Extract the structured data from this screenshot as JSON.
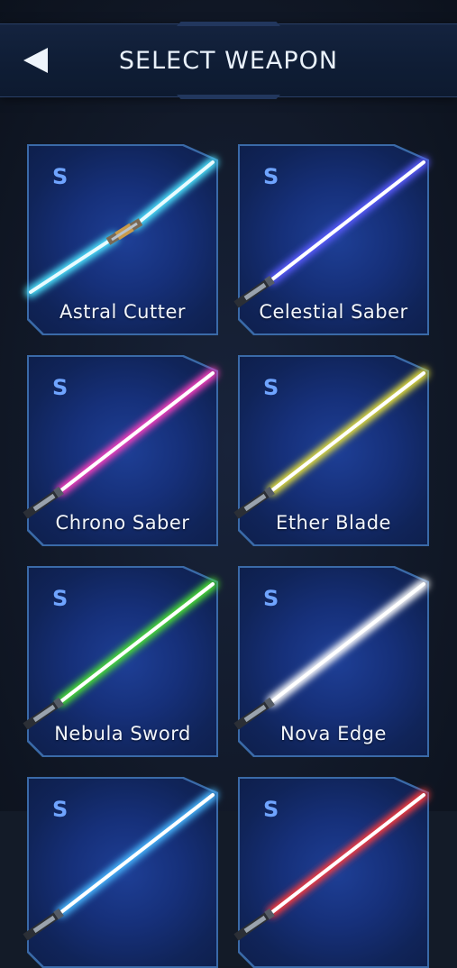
{
  "header": {
    "title": "SELECT WEAPON",
    "back_icon": "back-arrow-icon"
  },
  "weapons": [
    {
      "name": "Astral Cutter",
      "rank": "S",
      "color": "#4ee6ff",
      "double": true
    },
    {
      "name": "Celestial Saber",
      "rank": "S",
      "color": "#5b5cff",
      "double": false
    },
    {
      "name": "Chrono Saber",
      "rank": "S",
      "color": "#ff3fbf",
      "double": false
    },
    {
      "name": "Ether Blade",
      "rank": "S",
      "color": "#e8e33a",
      "double": false
    },
    {
      "name": "Nebula Sword",
      "rank": "S",
      "color": "#4be632",
      "double": false
    },
    {
      "name": "Nova Edge",
      "rank": "S",
      "color": "#ffffff",
      "double": false
    },
    {
      "name": "",
      "rank": "S",
      "color": "#4ab8ff",
      "double": false
    },
    {
      "name": "",
      "rank": "S",
      "color": "#ff3a3a",
      "double": false
    }
  ]
}
